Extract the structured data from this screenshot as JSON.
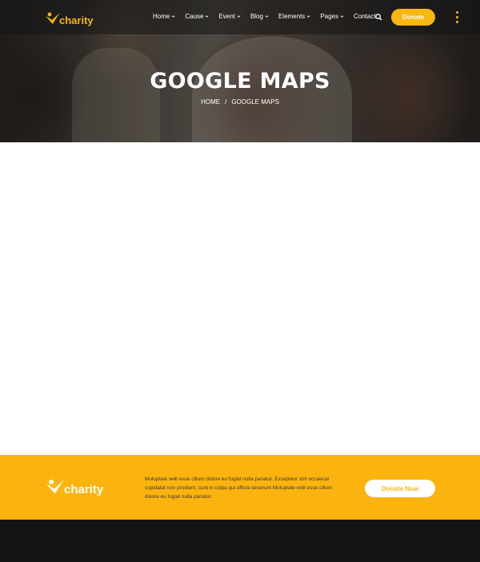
{
  "brand": {
    "name": "charity",
    "accent": "#f8b711"
  },
  "nav": {
    "items": [
      {
        "label": "Home",
        "has_dropdown": true
      },
      {
        "label": "Cause",
        "has_dropdown": true
      },
      {
        "label": "Event",
        "has_dropdown": true
      },
      {
        "label": "Blog",
        "has_dropdown": true
      },
      {
        "label": "Elements",
        "has_dropdown": true
      },
      {
        "label": "Pages",
        "has_dropdown": true
      },
      {
        "label": "Contact",
        "has_dropdown": false
      }
    ],
    "search_icon": "search-icon",
    "donate_label": "Donate",
    "more_icon": "vertical-dots-icon"
  },
  "hero": {
    "title": "GOOGLE MAPS",
    "breadcrumb": {
      "home": "HOME",
      "separator": "/",
      "current": "GOOGLE MAPS"
    }
  },
  "footer_cta": {
    "text": "Moluptate velit esse cillum dolore eu fugiat nulla pariatur. Excepteur sint occaecat cupidatat non proident, sunt in culpa qui officia deserunt Moluptate velit esse cillum dolore eu fugiat nulla pariatur.",
    "button_label": "Donate Now",
    "background": "#fbb40f"
  }
}
